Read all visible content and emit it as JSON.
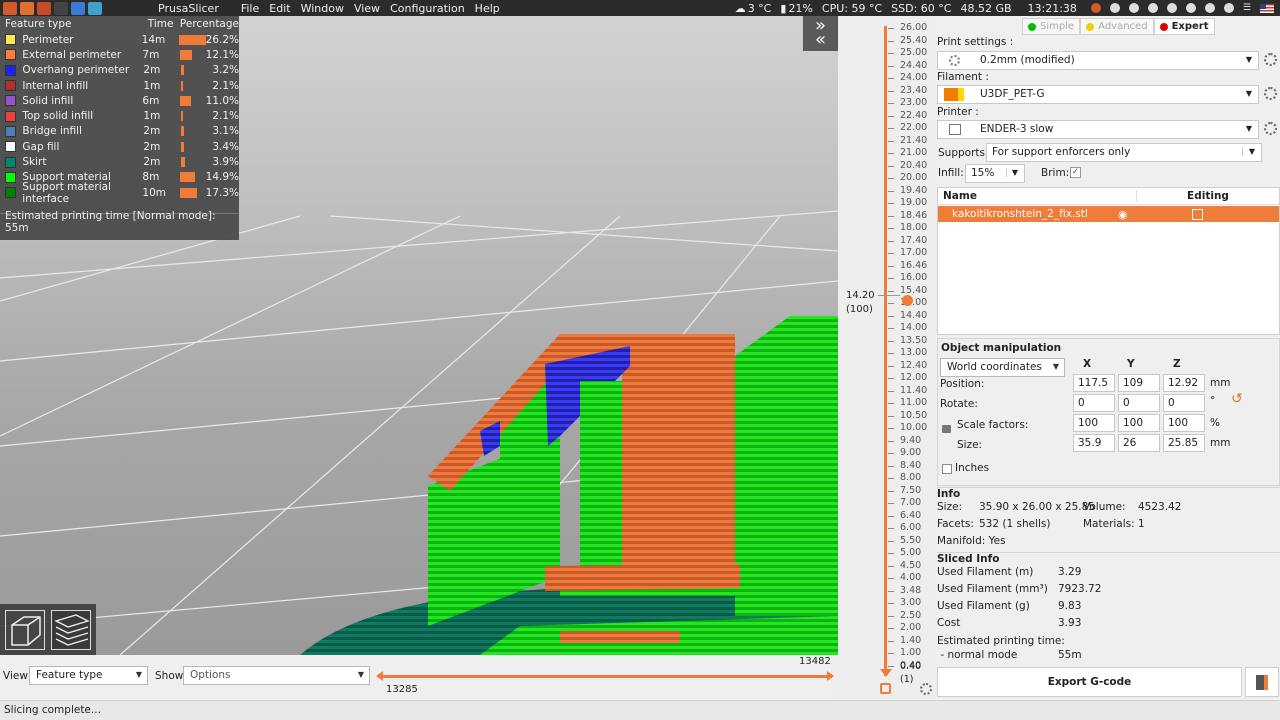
{
  "topbar": {
    "app_name": "PrusaSlicer",
    "menu": [
      "File",
      "Edit",
      "Window",
      "View",
      "Configuration",
      "Help"
    ],
    "weather": "3 °C",
    "battery": "21%",
    "cpu": "CPU: 59 °C",
    "ssd": "SSD: 60 °C",
    "disk": "48.52 GB",
    "clock": "13:21:38"
  },
  "legend": {
    "headers": [
      "Feature type",
      "Time",
      "Percentage"
    ],
    "rows": [
      {
        "name": "Perimeter",
        "time": "14m",
        "pct": "26.2%",
        "value": 26.2,
        "color": "#ffe650"
      },
      {
        "name": "External perimeter",
        "time": "7m",
        "pct": "12.1%",
        "value": 12.1,
        "color": "#ff7d38"
      },
      {
        "name": "Overhang perimeter",
        "time": "2m",
        "pct": "3.2%",
        "value": 3.2,
        "color": "#1f1fff"
      },
      {
        "name": "Internal infill",
        "time": "1m",
        "pct": "2.1%",
        "value": 2.1,
        "color": "#b03029"
      },
      {
        "name": "Solid infill",
        "time": "6m",
        "pct": "11.0%",
        "value": 11.0,
        "color": "#9654cc"
      },
      {
        "name": "Top solid infill",
        "time": "1m",
        "pct": "2.1%",
        "value": 2.1,
        "color": "#f04040"
      },
      {
        "name": "Bridge infill",
        "time": "2m",
        "pct": "3.1%",
        "value": 3.1,
        "color": "#4d80ba"
      },
      {
        "name": "Gap fill",
        "time": "2m",
        "pct": "3.4%",
        "value": 3.4,
        "color": "#ffffff"
      },
      {
        "name": "Skirt",
        "time": "2m",
        "pct": "3.9%",
        "value": 3.9,
        "color": "#00876e"
      },
      {
        "name": "Support material",
        "time": "8m",
        "pct": "14.9%",
        "value": 14.9,
        "color": "#00ff00"
      },
      {
        "name": "Support material interface",
        "time": "10m",
        "pct": "17.3%",
        "value": 17.3,
        "color": "#008000"
      }
    ],
    "estimated": "Estimated printing time [Normal mode]:",
    "estimated_value": "55m"
  },
  "bottombar": {
    "view_label": "View",
    "view_value": "Feature type",
    "show_label": "Show",
    "show_value": "Options",
    "slider_left": "13285",
    "slider_right": "13482"
  },
  "status": "Slicing complete...",
  "vslider": {
    "ticks": [
      "26.00",
      "25.40",
      "25.00",
      "24.40",
      "24.00",
      "23.40",
      "23.00",
      "22.40",
      "22.00",
      "21.40",
      "21.00",
      "20.40",
      "20.00",
      "19.40",
      "19.00",
      "18.46",
      "18.00",
      "17.40",
      "17.00",
      "16.46",
      "16.00",
      "15.40",
      "15.00",
      "14.40",
      "14.00",
      "13.50",
      "13.00",
      "12.40",
      "12.00",
      "11.40",
      "11.00",
      "10.50",
      "10.00",
      "9.40",
      "9.00",
      "8.40",
      "8.00",
      "7.50",
      "7.00",
      "6.40",
      "6.00",
      "5.50",
      "5.00",
      "4.50",
      "4.00",
      "3.48",
      "3.00",
      "2.50",
      "2.00",
      "1.40",
      "1.00",
      "0.40"
    ],
    "current": "14.20",
    "current_layer": "(100)",
    "bottom_value": "0.40",
    "bottom_layer": "(1)"
  },
  "sidebar": {
    "modes": [
      {
        "label": "Simple",
        "color": "#00c000"
      },
      {
        "label": "Advanced",
        "color": "#f0d000"
      },
      {
        "label": "Expert",
        "color": "#e00000"
      }
    ],
    "print_settings_label": "Print settings :",
    "print_settings_value": "0.2mm  (modified)",
    "filament_label": "Filament :",
    "filament_value": "U3DF_PET-G",
    "filament_color": "#f07c00",
    "printer_label": "Printer :",
    "printer_value": "ENDER-3 slow",
    "supports_label": "Supports:",
    "supports_value": "For support enforcers only",
    "infill_label": "Infill:",
    "infill_value": "15%",
    "brim_label": "Brim:",
    "objects": {
      "name_header": "Name",
      "editing_header": "Editing",
      "items": [
        "kakoitikronshtein_2_fix.stl"
      ]
    },
    "manip": {
      "title": "Object manipulation",
      "coords": "World coordinates",
      "x": "X",
      "y": "Y",
      "z": "Z",
      "position_label": "Position:",
      "position": [
        "117.5",
        "109",
        "12.92"
      ],
      "rotate_label": "Rotate:",
      "rotate": [
        "0",
        "0",
        "0"
      ],
      "scale_label": "Scale factors:",
      "scale": [
        "100",
        "100",
        "100"
      ],
      "size_label": "Size:",
      "size": [
        "35.9",
        "26",
        "25.85"
      ],
      "unit_mm": "mm",
      "unit_deg": "°",
      "unit_pct": "%",
      "inches": "Inches"
    },
    "info": {
      "title": "Info",
      "size_label": "Size:",
      "size": "35.90 x 26.00 x 25.85",
      "volume_label": "Volume:",
      "volume": "4523.42",
      "facets_label": "Facets:",
      "facets": "532 (1 shells)",
      "materials_label": "Materials:",
      "materials": "1",
      "manifold": "Manifold: Yes"
    },
    "sliced": {
      "title": "Sliced Info",
      "rows": [
        {
          "k": "Used Filament (m)",
          "v": "3.29"
        },
        {
          "k": "Used Filament (mm³)",
          "v": "7923.72"
        },
        {
          "k": "Used Filament (g)",
          "v": "9.83"
        },
        {
          "k": "Cost",
          "v": "3.93"
        }
      ],
      "est_label": "Estimated printing time:",
      "mode_label": " - normal mode",
      "mode_value": "55m"
    },
    "export": "Export G-code"
  }
}
